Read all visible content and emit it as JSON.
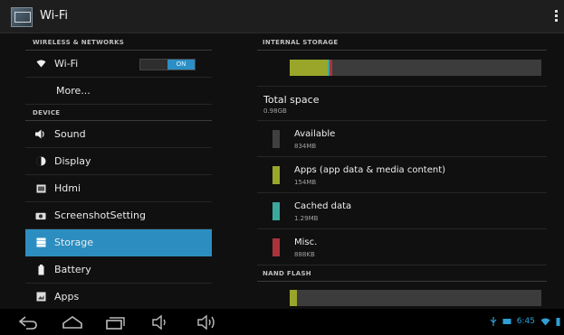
{
  "action_bar": {
    "title": "Wi-Fi"
  },
  "left_pane": {
    "wireless_header": "WIRELESS & NETWORKS",
    "wifi": {
      "label": "Wi-Fi",
      "toggle": "ON"
    },
    "more": "More...",
    "device_header": "DEVICE",
    "items": [
      {
        "label": "Sound",
        "icon": "speaker-icon"
      },
      {
        "label": "Display",
        "icon": "brightness-icon"
      },
      {
        "label": "Hdmi",
        "icon": "hdmi-icon"
      },
      {
        "label": "ScreenshotSetting",
        "icon": "camera-icon"
      },
      {
        "label": "Storage",
        "icon": "storage-icon",
        "selected": true
      },
      {
        "label": "Battery",
        "icon": "battery-icon"
      },
      {
        "label": "Apps",
        "icon": "apps-icon"
      }
    ]
  },
  "right_pane": {
    "internal_header": "INTERNAL STORAGE",
    "total": {
      "label": "Total space",
      "value": "0.98GB"
    },
    "legend": [
      {
        "label": "Available",
        "value": "834MB",
        "color": "#404040"
      },
      {
        "label": "Apps (app data & media content)",
        "value": "154MB",
        "color": "#9aa62a"
      },
      {
        "label": "Cached data",
        "value": "1.29MB",
        "color": "#3aa89c"
      },
      {
        "label": "Misc.",
        "value": "888KB",
        "color": "#a8343a"
      }
    ],
    "nand_header": "NAND FLASH"
  },
  "status_bar": {
    "time": "6:45"
  },
  "colors": {
    "accent": "#2c8ec0",
    "apps": "#9aa62a",
    "cached": "#3aa89c",
    "misc": "#a8343a",
    "available": "#404040"
  }
}
